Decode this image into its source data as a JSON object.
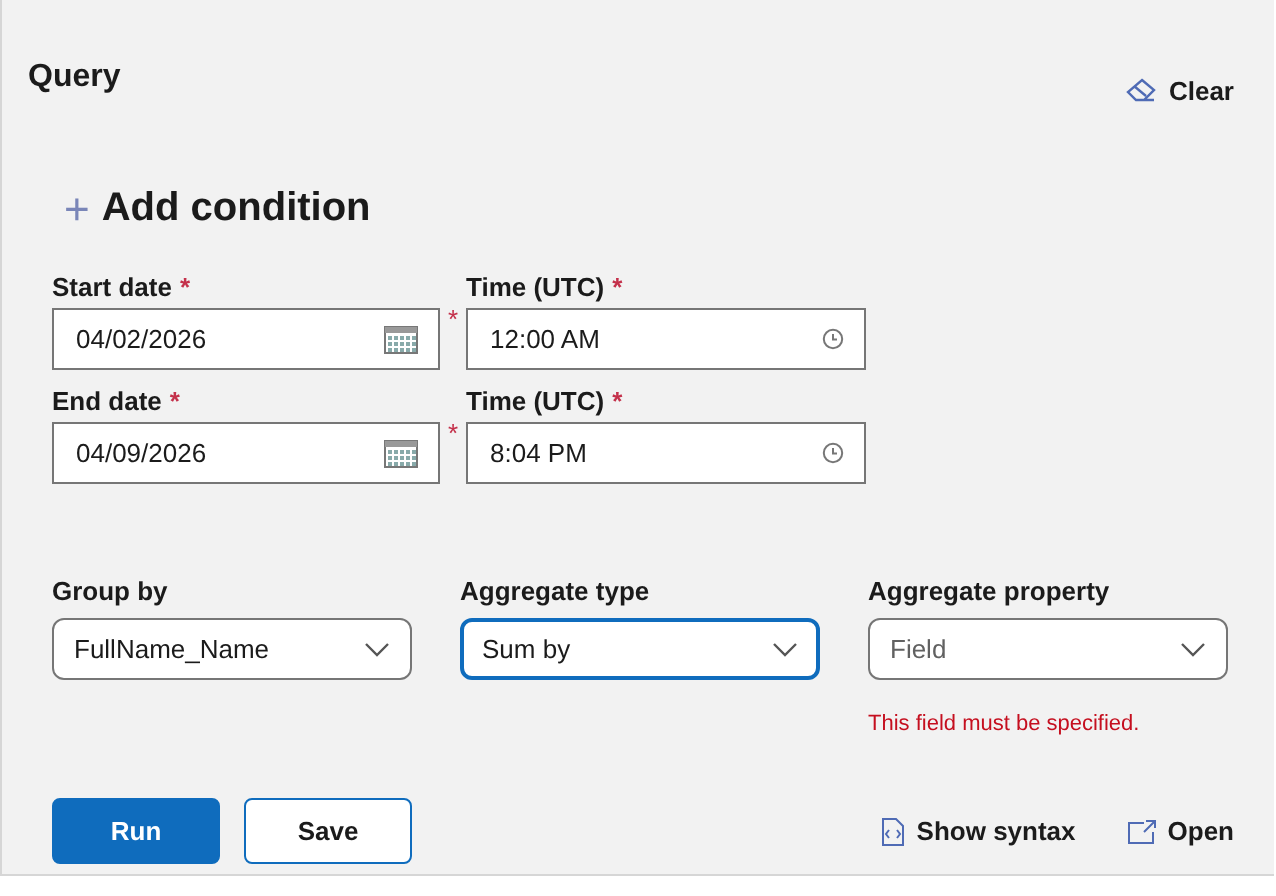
{
  "title": "Query",
  "clear_button": {
    "label": "Clear"
  },
  "add_condition": {
    "icon": "+",
    "label": "Add condition"
  },
  "datetime_rows": [
    {
      "date": {
        "label": "Start date",
        "required_mark": "*",
        "value": "04/02/2026"
      },
      "time": {
        "label": "Time (UTC)",
        "required_mark": "*",
        "side_mark": "*",
        "value": "12:00 AM"
      }
    },
    {
      "date": {
        "label": "End date",
        "required_mark": "*",
        "value": "04/09/2026"
      },
      "time": {
        "label": "Time (UTC)",
        "required_mark": "*",
        "side_mark": "*",
        "value": "8:04 PM"
      }
    }
  ],
  "dropdowns": [
    {
      "label": "Group by",
      "value": "FullName_Name",
      "focused": false
    },
    {
      "label": "Aggregate type",
      "value": "Sum by",
      "focused": true
    },
    {
      "label": "Aggregate property",
      "placeholder": "Field",
      "focused": false,
      "error": "This field must be specified."
    }
  ],
  "buttons": [
    {
      "label": "Run",
      "kind": "primary"
    },
    {
      "label": "Save",
      "kind": "secondary"
    }
  ],
  "links": [
    {
      "label": "Show syntax",
      "kind": "syntax"
    },
    {
      "label": "Open",
      "kind": "open"
    }
  ]
}
